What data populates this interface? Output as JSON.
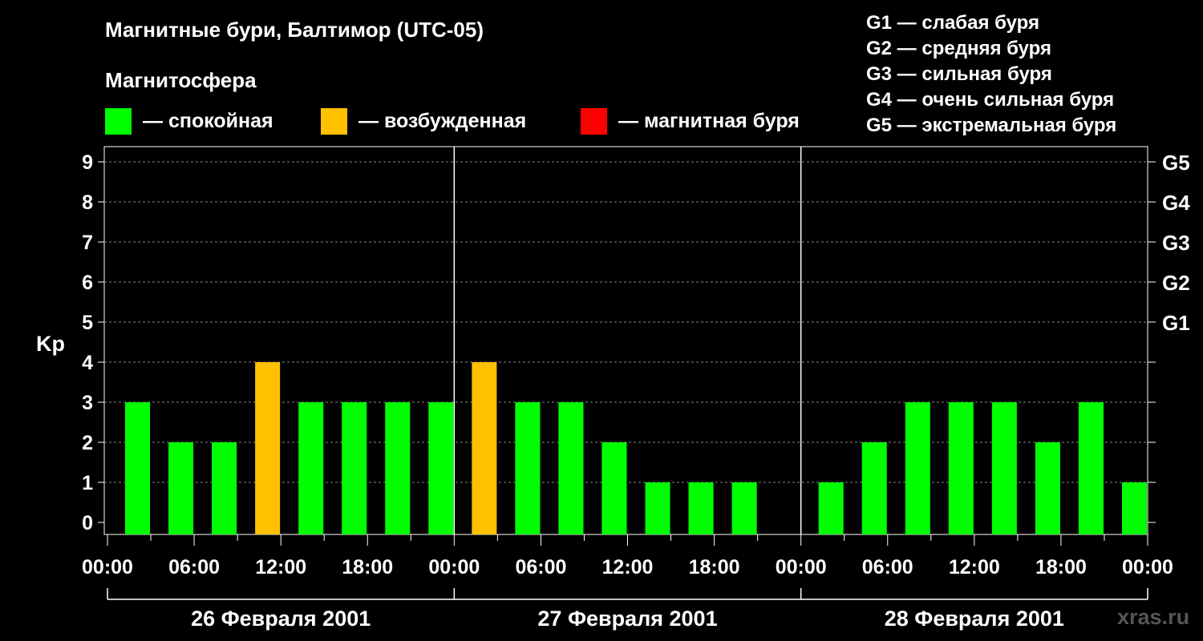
{
  "chart_data": {
    "type": "bar",
    "title": "Магнитные бури, Балтимор (UTC-05)",
    "subtitle": "Магнитосфера",
    "ylabel": "Kp",
    "ylim": [
      0,
      9
    ],
    "yticks": [
      "0",
      "1",
      "2",
      "3",
      "4",
      "5",
      "6",
      "7",
      "8",
      "9"
    ],
    "right_ticks": [
      {
        "kp": 5,
        "label": "G1"
      },
      {
        "kp": 6,
        "label": "G2"
      },
      {
        "kp": 7,
        "label": "G3"
      },
      {
        "kp": 8,
        "label": "G4"
      },
      {
        "kp": 9,
        "label": "G5"
      }
    ],
    "xticks": [
      "00:00",
      "06:00",
      "12:00",
      "18:00",
      "00:00",
      "06:00",
      "12:00",
      "18:00",
      "00:00",
      "06:00",
      "12:00",
      "18:00",
      "00:00"
    ],
    "days": [
      "26 Февраля 2001",
      "27 Февраля 2001",
      "28 Февраля 2001"
    ],
    "legend": [
      {
        "label": "— спокойная",
        "color": "#00ff00"
      },
      {
        "label": "— возбужденная",
        "color": "#ffc000"
      },
      {
        "label": "— магнитная буря",
        "color": "#ff0000"
      }
    ],
    "scale_notes": [
      "G1 — слабая буря",
      "G2 — средняя буря",
      "G3 — сильная буря",
      "G4 — очень сильная буря",
      "G5 — экстремальная буря"
    ],
    "grid": true,
    "interval_hours": 3,
    "values": [
      3,
      2,
      2,
      4,
      3,
      3,
      3,
      3,
      4,
      3,
      3,
      2,
      1,
      1,
      1,
      null,
      1,
      2,
      3,
      3,
      3,
      2,
      3,
      1
    ],
    "colors": {
      "quiet": "#00ff00",
      "active": "#ffc000",
      "storm": "#ff0000"
    }
  },
  "watermark": "xras.ru"
}
